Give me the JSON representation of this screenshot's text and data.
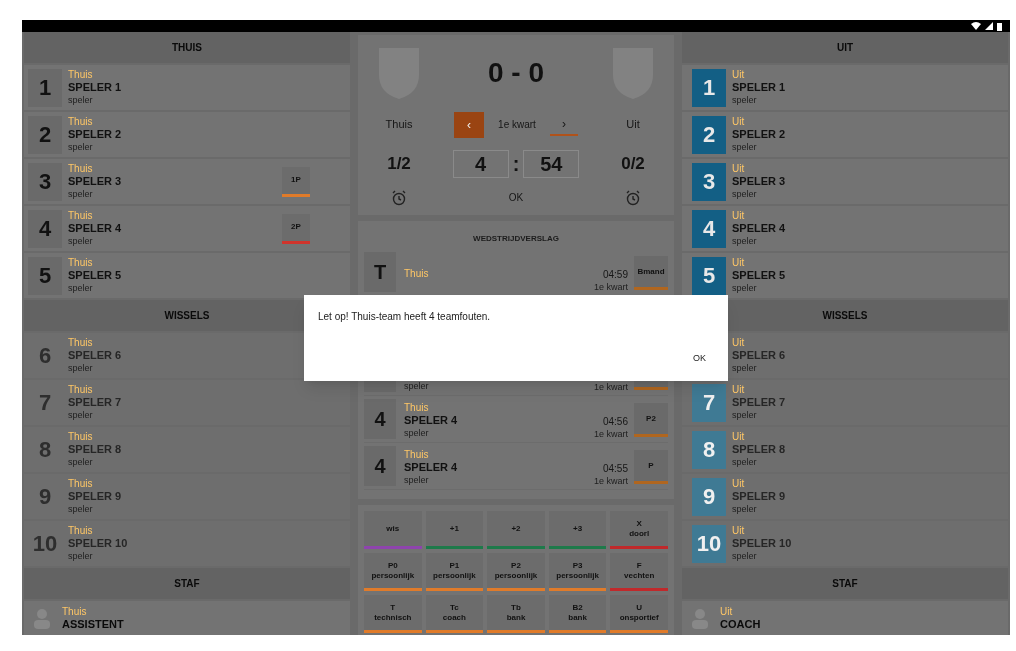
{
  "home": {
    "title": "THUIS",
    "players": [
      {
        "number": "1",
        "team": "Thuis",
        "name": "SPELER 1",
        "role": "speler",
        "active": true
      },
      {
        "number": "2",
        "team": "Thuis",
        "name": "SPELER 2",
        "role": "speler",
        "active": true
      },
      {
        "number": "3",
        "team": "Thuis",
        "name": "SPELER 3",
        "role": "speler",
        "active": true,
        "badge": {
          "label": "1P",
          "color": "#e07b2a"
        }
      },
      {
        "number": "4",
        "team": "Thuis",
        "name": "SPELER 4",
        "role": "speler",
        "active": true,
        "badge": {
          "label": "2P",
          "color": "#d0342c"
        }
      },
      {
        "number": "5",
        "team": "Thuis",
        "name": "SPELER 5",
        "role": "speler",
        "active": true
      }
    ],
    "subs_title": "WISSELS",
    "subs": [
      {
        "number": "6",
        "team": "Thuis",
        "name": "SPELER 6",
        "role": "speler",
        "active": false
      },
      {
        "number": "7",
        "team": "Thuis",
        "name": "SPELER 7",
        "role": "speler",
        "active": false
      },
      {
        "number": "8",
        "team": "Thuis",
        "name": "SPELER 8",
        "role": "speler",
        "active": false
      },
      {
        "number": "9",
        "team": "Thuis",
        "name": "SPELER 9",
        "role": "speler",
        "active": false
      },
      {
        "number": "10",
        "team": "Thuis",
        "name": "SPELER 10",
        "role": "speler",
        "active": false
      }
    ],
    "staff_title": "STAF",
    "staff": {
      "team": "Thuis",
      "name": "ASSISTENT"
    }
  },
  "scoreboard": {
    "score": "0 - 0",
    "home_name": "Thuis",
    "away_name": "Uit",
    "prev": "‹",
    "period": "1e kwart",
    "next": "›",
    "home_timeouts": "1/2",
    "minutes": "4",
    "separator": ":",
    "seconds": "54",
    "away_timeouts": "0/2",
    "ok": "OK"
  },
  "report": {
    "title": "WEDSTRIJDVERSLAG",
    "events": [
      {
        "number": "T",
        "team": "Thuis",
        "time": "04:59",
        "quarter": "1e kwart",
        "badge": "Bmand"
      },
      {
        "role": "speler",
        "quarter": "1e kwart"
      },
      {
        "number": "4",
        "team": "Thuis",
        "name": "SPELER 4",
        "role": "speler",
        "time": "04:56",
        "quarter": "1e kwart",
        "badge": "P2"
      },
      {
        "number": "4",
        "team": "Thuis",
        "name": "SPELER 4",
        "role": "speler",
        "time": "04:55",
        "quarter": "1e kwart",
        "badge": "P"
      }
    ]
  },
  "actions": [
    {
      "code": "wis",
      "color": "#8e44ad"
    },
    {
      "code": "+1",
      "color": "#1e7a4a"
    },
    {
      "code": "+2",
      "color": "#1e7a4a"
    },
    {
      "code": "+3",
      "color": "#1e7a4a"
    },
    {
      "code": "X",
      "desc": "doorl",
      "color": "#c0292b"
    },
    {
      "code": "P0",
      "desc": "persoonlijk",
      "color": "#e07b2a"
    },
    {
      "code": "P1",
      "desc": "persoonlijk",
      "color": "#e07b2a"
    },
    {
      "code": "P2",
      "desc": "persoonlijk",
      "color": "#e07b2a"
    },
    {
      "code": "P3",
      "desc": "persoonlijk",
      "color": "#e07b2a"
    },
    {
      "code": "F",
      "desc": "vechten",
      "color": "#c0292b"
    },
    {
      "code": "T",
      "desc": "technisch",
      "color": "#e07b2a"
    },
    {
      "code": "Tc",
      "desc": "coach",
      "color": "#e07b2a"
    },
    {
      "code": "Tb",
      "desc": "bank",
      "color": "#e07b2a"
    },
    {
      "code": "B2",
      "desc": "bank",
      "color": "#e07b2a"
    },
    {
      "code": "U",
      "desc": "onsportief",
      "color": "#e07b2a"
    }
  ],
  "away": {
    "title": "UIT",
    "players": [
      {
        "number": "1",
        "team": "Uit",
        "name": "SPELER 1",
        "role": "speler",
        "active": true
      },
      {
        "number": "2",
        "team": "Uit",
        "name": "SPELER 2",
        "role": "speler",
        "active": true
      },
      {
        "number": "3",
        "team": "Uit",
        "name": "SPELER 3",
        "role": "speler",
        "active": true
      },
      {
        "number": "4",
        "team": "Uit",
        "name": "SPELER 4",
        "role": "speler",
        "active": true
      },
      {
        "number": "5",
        "team": "Uit",
        "name": "SPELER 5",
        "role": "speler",
        "active": true
      }
    ],
    "subs_title": "WISSELS",
    "subs": [
      {
        "team": "Uit",
        "name": "SPELER 6",
        "role": "speler",
        "active": false
      },
      {
        "number": "7",
        "team": "Uit",
        "name": "SPELER 7",
        "role": "speler",
        "active": false
      },
      {
        "number": "8",
        "team": "Uit",
        "name": "SPELER 8",
        "role": "speler",
        "active": false
      },
      {
        "number": "9",
        "team": "Uit",
        "name": "SPELER 9",
        "role": "speler",
        "active": false
      },
      {
        "number": "10",
        "team": "Uit",
        "name": "SPELER 10",
        "role": "speler",
        "active": false
      }
    ],
    "staff_title": "STAF",
    "staff": {
      "team": "Uit",
      "name": "COACH"
    }
  },
  "dialog": {
    "message": "Let op! Thuis-team heeft 4 teamfouten.",
    "button": "OK"
  }
}
